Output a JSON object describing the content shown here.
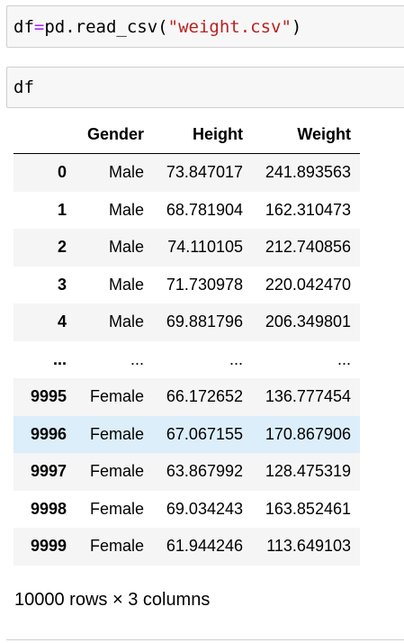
{
  "cells": {
    "cell1": {
      "var": "df",
      "op": "=",
      "call_prefix": "pd.read_csv(",
      "string_arg": "\"weight.csv\"",
      "call_suffix": ")"
    },
    "cell2": {
      "code": "df"
    }
  },
  "dataframe": {
    "columns": [
      "",
      "Gender",
      "Height",
      "Weight"
    ],
    "rows": [
      {
        "index": "0",
        "gender": "Male",
        "height": "73.847017",
        "weight": "241.893563"
      },
      {
        "index": "1",
        "gender": "Male",
        "height": "68.781904",
        "weight": "162.310473"
      },
      {
        "index": "2",
        "gender": "Male",
        "height": "74.110105",
        "weight": "212.740856"
      },
      {
        "index": "3",
        "gender": "Male",
        "height": "71.730978",
        "weight": "220.042470"
      },
      {
        "index": "4",
        "gender": "Male",
        "height": "69.881796",
        "weight": "206.349801"
      },
      {
        "index": "...",
        "gender": "...",
        "height": "...",
        "weight": "..."
      },
      {
        "index": "9995",
        "gender": "Female",
        "height": "66.172652",
        "weight": "136.777454"
      },
      {
        "index": "9996",
        "gender": "Female",
        "height": "67.067155",
        "weight": "170.867906"
      },
      {
        "index": "9997",
        "gender": "Female",
        "height": "63.867992",
        "weight": "128.475319"
      },
      {
        "index": "9998",
        "gender": "Female",
        "height": "69.034243",
        "weight": "163.852461"
      },
      {
        "index": "9999",
        "gender": "Female",
        "height": "61.944246",
        "weight": "113.649103"
      }
    ],
    "summary": "10000 rows × 3 columns"
  },
  "colors": {
    "cell_bg": "#f7f7f7",
    "cell_border": "#cfcfcf",
    "operator": "#aa22ff",
    "string": "#ba2121",
    "row_alt": "#f5f5f5",
    "row_hover": "#dceefa"
  }
}
